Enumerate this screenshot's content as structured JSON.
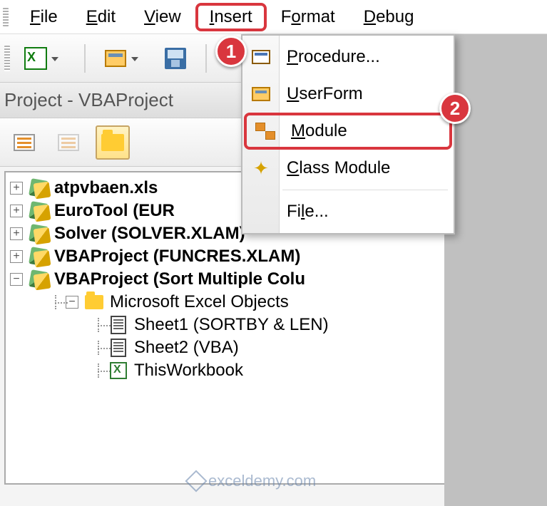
{
  "menubar": {
    "items": [
      {
        "label": "File",
        "ul": "F"
      },
      {
        "label": "Edit",
        "ul": "E"
      },
      {
        "label": "View",
        "ul": "V"
      },
      {
        "label": "Insert",
        "ul": "I"
      },
      {
        "label": "Format",
        "ul": "o"
      },
      {
        "label": "Debug",
        "ul": "D"
      }
    ]
  },
  "panel": {
    "title": "Project - VBAProject"
  },
  "dropdown": {
    "items": {
      "procedure": "Procedure...",
      "userform": "UserForm",
      "module": "Module",
      "classmodule": "Class Module",
      "file": "File..."
    }
  },
  "tree": {
    "projects": [
      {
        "label": "atpvbaen.xls",
        "expanded": false
      },
      {
        "label": "EuroTool (EUR",
        "expanded": false
      },
      {
        "label": "Solver (SOLVER.XLAM)",
        "expanded": false
      },
      {
        "label": "VBAProject (FUNCRES.XLAM)",
        "expanded": false
      },
      {
        "label": "VBAProject (Sort Multiple Colu",
        "expanded": true
      }
    ],
    "folder": "Microsoft Excel Objects",
    "sheets": [
      "Sheet1 (SORTBY & LEN)",
      "Sheet2 (VBA)"
    ],
    "workbook": "ThisWorkbook"
  },
  "callouts": {
    "one": "1",
    "two": "2"
  },
  "watermark": "exceldemy.com"
}
